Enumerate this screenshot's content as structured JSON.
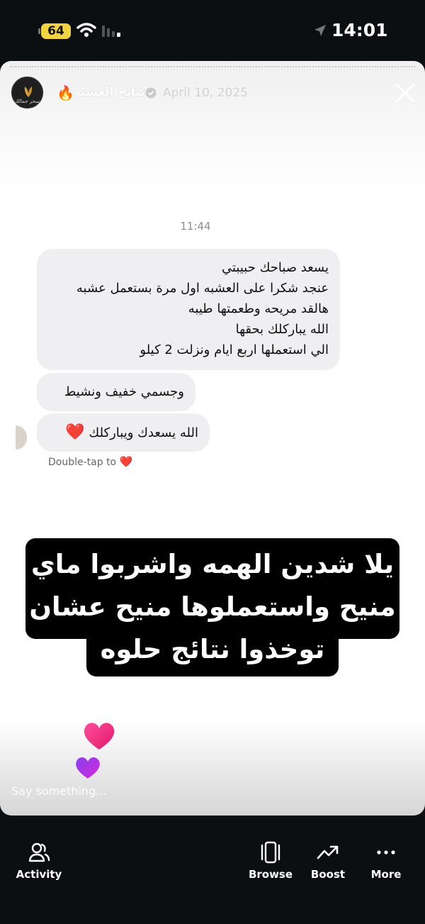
{
  "status_bar": {
    "battery": "64",
    "time": "14:01"
  },
  "story": {
    "account_name": "نتائج العشبه",
    "account_emoji": "🔥",
    "avatar_text": "سحر جمالك",
    "date": "April 10, 2025",
    "chat": {
      "time": "11:44",
      "messages": [
        {
          "lines": [
            "يسعد صباحك حبيبتي",
            "عنجد شكرا على العشبه اول مرة بستعمل عشبه",
            "هالقد مريحه وطعمتها طيبه",
            "الله يباركلك بحقها",
            "الي استعملها اربع ايام ونزلت 2 كيلو"
          ]
        },
        {
          "text": "وجسمي خفيف ونشيط"
        },
        {
          "text": "الله يسعدك ويباركلك",
          "emoji": "❤️"
        }
      ],
      "double_tap": "Double-tap to",
      "double_tap_emoji": "❤️"
    },
    "caption": {
      "line1": "يلا شدين الهمه واشربوا ماي",
      "line2": "منيح واستعملوها منيح عشان",
      "line3": "توخذوا نتائج حلوه"
    },
    "reply_placeholder": "Say something..."
  },
  "bottom_nav": {
    "items": [
      {
        "label": "Activity",
        "icon": "people-icon"
      },
      {
        "label": "Browse",
        "icon": "browse-icon"
      },
      {
        "label": "Boost",
        "icon": "trend-icon"
      },
      {
        "label": "More",
        "icon": "more-icon"
      }
    ]
  },
  "colors": {
    "background": "#0b0f12",
    "bubble": "#efeff2",
    "battery": "#f2d340",
    "heart": "#e0202f"
  }
}
